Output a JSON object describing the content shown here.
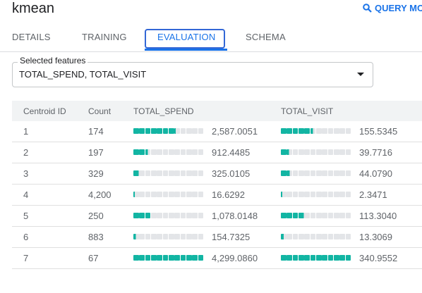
{
  "header": {
    "title": "kmean",
    "query_label": "QUERY MO"
  },
  "tabs": [
    {
      "label": "DETAILS",
      "active": false
    },
    {
      "label": "TRAINING",
      "active": false
    },
    {
      "label": "EVALUATION",
      "active": true
    },
    {
      "label": "SCHEMA",
      "active": false
    }
  ],
  "features": {
    "label": "Selected features",
    "value": "TOTAL_SPEND, TOTAL_VISIT"
  },
  "table": {
    "headers": [
      "Centroid ID",
      "Count",
      "TOTAL_SPEND",
      "TOTAL_VISIT"
    ],
    "rows": [
      {
        "id": "1",
        "count": "174",
        "spend": "2,587.0051",
        "spend_fill": 0.6,
        "visit": "155.5345",
        "visit_fill": 0.46
      },
      {
        "id": "2",
        "count": "197",
        "spend": "912.4485",
        "spend_fill": 0.21,
        "visit": "39.7716",
        "visit_fill": 0.12
      },
      {
        "id": "3",
        "count": "329",
        "spend": "325.0105",
        "spend_fill": 0.08,
        "visit": "44.0790",
        "visit_fill": 0.13
      },
      {
        "id": "4",
        "count": "4,200",
        "spend": "16.6292",
        "spend_fill": 0.004,
        "visit": "2.3471",
        "visit_fill": 0.007
      },
      {
        "id": "5",
        "count": "250",
        "spend": "1,078.0148",
        "spend_fill": 0.25,
        "visit": "113.3040",
        "visit_fill": 0.33
      },
      {
        "id": "6",
        "count": "883",
        "spend": "154.7325",
        "spend_fill": 0.036,
        "visit": "13.3069",
        "visit_fill": 0.04
      },
      {
        "id": "7",
        "count": "67",
        "spend": "4,299.0860",
        "spend_fill": 1.0,
        "visit": "340.9552",
        "visit_fill": 1.0
      }
    ]
  },
  "colors": {
    "bar_fill": "#12b5a3",
    "bar_empty": "#e3e5e8",
    "accent": "#1a73e8"
  }
}
